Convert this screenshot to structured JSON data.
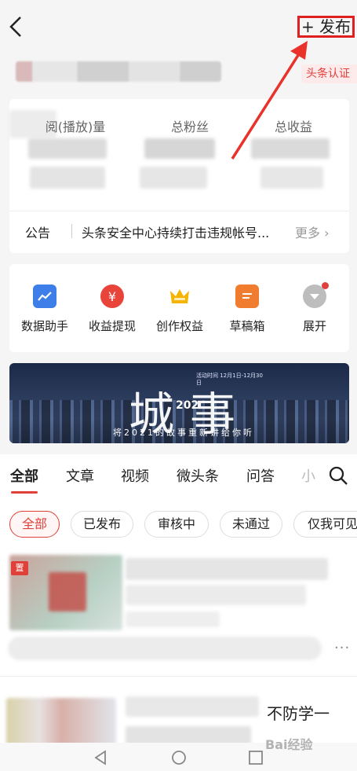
{
  "header": {
    "publish_label": "+ 发布",
    "verified_label": "头条认证"
  },
  "stats": {
    "items": [
      {
        "label": "阅(播放)量"
      },
      {
        "label": "总粉丝"
      },
      {
        "label": "总收益"
      }
    ],
    "notice": {
      "tag": "公告",
      "text": "头条安全中心持续打击违规帐号...",
      "more": "更多 ›"
    }
  },
  "tools": [
    {
      "label": "数据助手",
      "icon": "chart-icon",
      "color": "#3d7ee8"
    },
    {
      "label": "收益提现",
      "icon": "yen-icon",
      "color": "#e8443a"
    },
    {
      "label": "创作权益",
      "icon": "crown-icon",
      "color": "#f4b400"
    },
    {
      "label": "草稿箱",
      "icon": "draft-icon",
      "color": "#f07c30"
    },
    {
      "label": "展开",
      "icon": "expand-icon",
      "color": "#b5b5b5"
    }
  ],
  "banner": {
    "title": "城事",
    "overlay_year": "202",
    "subtitle": "将2021的故事重新讲给你听",
    "small_text": "活动时间 12月1日-12月30日"
  },
  "tabs": [
    "全部",
    "文章",
    "视频",
    "微头条",
    "问答",
    "小"
  ],
  "filters": [
    "全部",
    "已发布",
    "审核中",
    "未通过",
    "仅我可见"
  ],
  "feed": {
    "pinned_label": "置",
    "more_label": "···",
    "second_title_fragment": "不防学一"
  },
  "watermark": "Bai经验",
  "colors": {
    "accent": "#e0403a",
    "background": "#f5f5f5"
  }
}
